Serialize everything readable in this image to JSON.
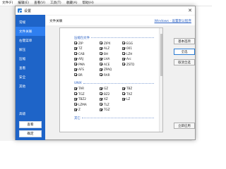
{
  "app_menu": [
    "文件(F)",
    "编辑(E)",
    "查看(V)",
    "工具(T)",
    "收藏(A)",
    "帮助(H)"
  ],
  "dialog": {
    "title": "设置",
    "close_glyph": "✕"
  },
  "sidebar": {
    "items": [
      {
        "label": "常规"
      },
      {
        "label": "文件关联"
      },
      {
        "label": "右键菜单"
      },
      {
        "label": "解压"
      },
      {
        "label": "压缩"
      },
      {
        "label": "查看"
      },
      {
        "label": "安全"
      },
      {
        "label": "其他"
      }
    ],
    "active_index": 1,
    "bottom_items": [
      {
        "label": "高级"
      }
    ],
    "buttons": [
      "查看",
      "确定"
    ]
  },
  "header": {
    "label": "文件关联",
    "link": "Windows · 设置默认程序"
  },
  "groups": [
    {
      "name": "压缩包文件",
      "items": [
        "ZIP",
        "7Z",
        "CAB",
        "ARJ",
        "PMA",
        "AFS",
        "BR",
        "ZIPX",
        "ALZ",
        "BH",
        "LHA",
        "ACE",
        "ZPAQ",
        "RAR",
        "EGG",
        "001",
        "LZH",
        "Arc",
        "ZSTD"
      ]
    },
    {
      "name": "UNIX",
      "items": [
        "TAR",
        "TGZ",
        "TBZ2",
        "LZMA",
        "Z",
        "GZ",
        "BZ2",
        "XZ",
        "TLZ",
        "TGZ",
        "TBZ",
        "TXZ",
        "LZ"
      ]
    },
    {
      "name": "其它",
      "items": []
    }
  ],
  "right_buttons": [
    "基本选项",
    "全选",
    "取消全选",
    "立即应用"
  ],
  "colors": {
    "sidebar": "#1e64c8",
    "sidebar_active": "#2f7ff0",
    "link": "#2b61c4",
    "primary_border": "#2b7cd3"
  }
}
